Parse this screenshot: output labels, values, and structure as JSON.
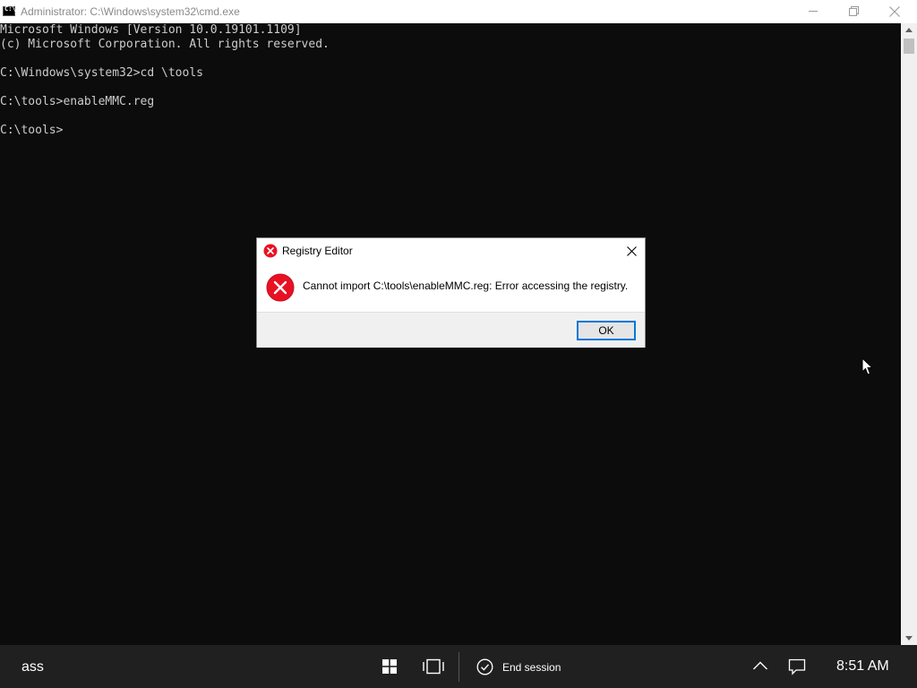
{
  "window": {
    "title": "Administrator: C:\\Windows\\system32\\cmd.exe"
  },
  "console": {
    "lines": [
      "Microsoft Windows [Version 10.0.19101.1109]",
      "(c) Microsoft Corporation. All rights reserved.",
      "",
      "C:\\Windows\\system32>cd \\tools",
      "",
      "C:\\tools>enableMMC.reg",
      "",
      "C:\\tools>"
    ]
  },
  "dialog": {
    "title": "Registry Editor",
    "message": "Cannot import C:\\tools\\enableMMC.reg: Error accessing the registry.",
    "ok_label": "OK",
    "icon": "error-icon",
    "error_color": "#e81123"
  },
  "taskbar": {
    "user_label": "ass",
    "session_label": "End session",
    "clock": "8:51 AM",
    "icons": [
      "windows-start-icon",
      "task-view-icon",
      "end-session-check-icon",
      "chevron-up-icon",
      "notification-icon"
    ]
  },
  "colors": {
    "console_bg": "#0c0c0c",
    "console_text": "#cccccc",
    "taskbar_bg": "#202020",
    "focus_accent": "#0078d7"
  }
}
